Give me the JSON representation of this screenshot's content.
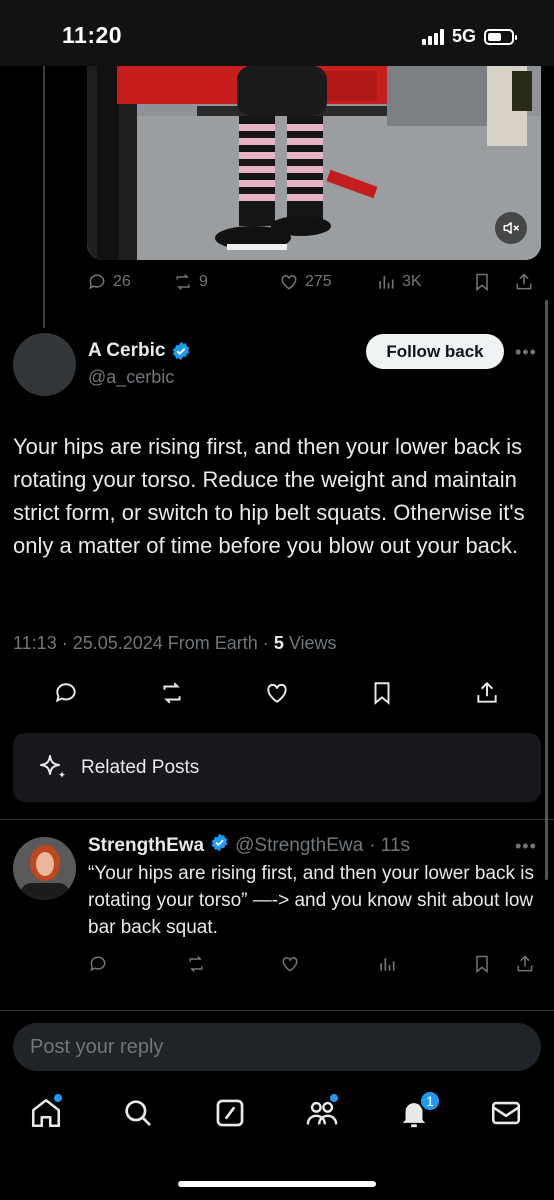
{
  "status_bar": {
    "time": "11:20",
    "network": "5G"
  },
  "parent_tweet": {
    "actions": {
      "replies": "26",
      "reposts": "9",
      "likes": "275",
      "views": "3K"
    }
  },
  "main_tweet": {
    "author_name": "A Cerbic",
    "author_handle": "@a_cerbic",
    "follow_label": "Follow back",
    "text": "Your hips are rising first, and then your lower back is rotating your torso. Reduce the weight and maintain strict form, or switch to hip belt squats. Otherwise it's only a matter of time before you blow out your back.",
    "timestamp": "11:13 · 25.05.2024 From Earth · ",
    "views_count": "5",
    "views_label": " Views"
  },
  "related_posts": {
    "label": "Related Posts"
  },
  "reply": {
    "author_name": "StrengthEwa",
    "author_handle": "@StrengthEwa",
    "time": "· 11s",
    "text": "“Your hips are rising first, and then your lower back is rotating your torso” —-> and you know shit about low bar back squat."
  },
  "reply_box": {
    "placeholder": "Post your reply"
  },
  "bottom_nav": {
    "notifications_badge": "1"
  },
  "colors": {
    "accent": "#1d9bf0",
    "background": "#000000",
    "muted_text": "#71767b"
  }
}
